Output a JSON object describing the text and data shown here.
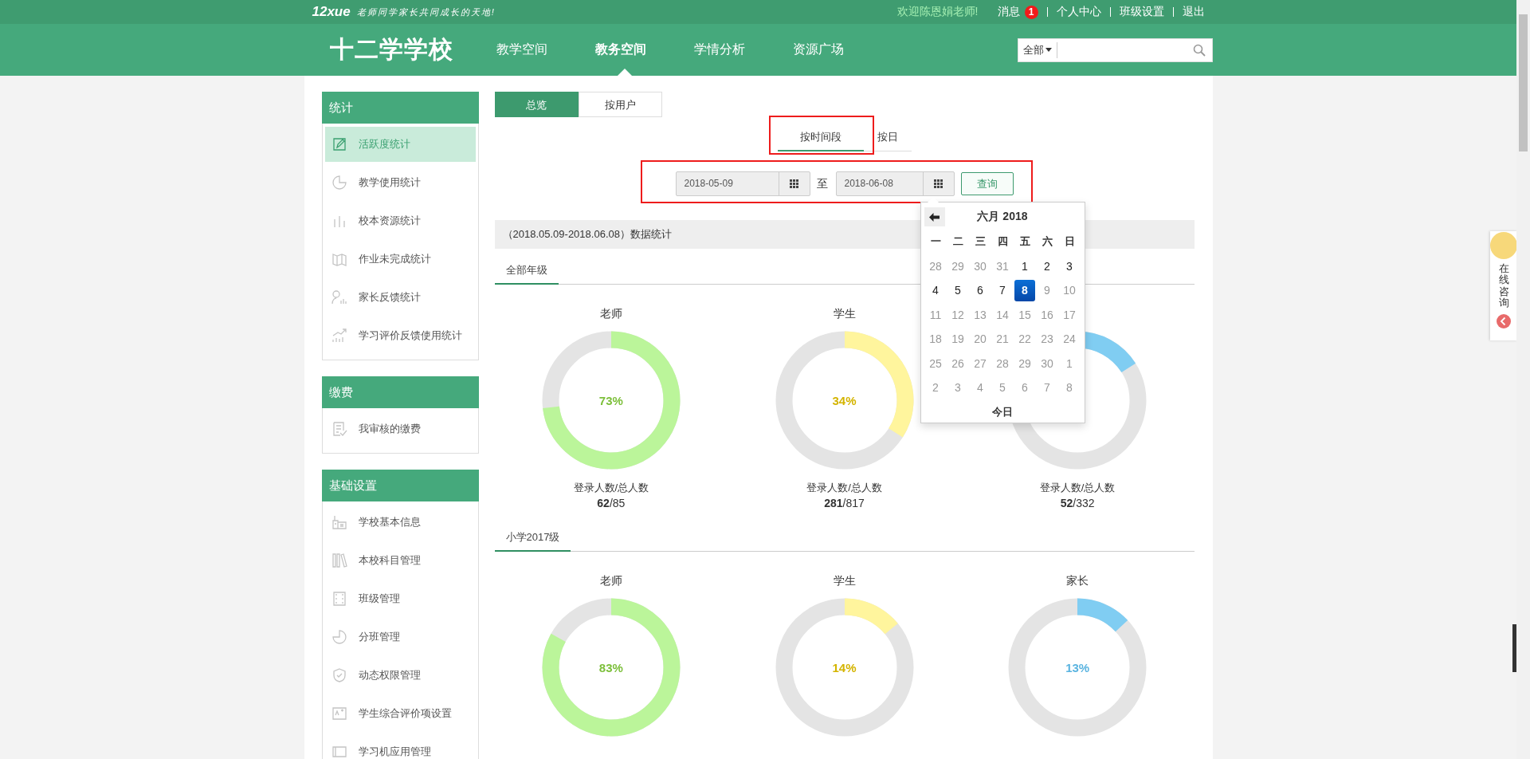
{
  "topbar": {
    "logo": "12xue",
    "tagline": "老师同学家长共同成长的天地!",
    "welcome": "欢迎陈恩娟老师!",
    "links": [
      {
        "label": "消息",
        "badge": "1"
      },
      {
        "label": "个人中心"
      },
      {
        "label": "班级设置"
      },
      {
        "label": "退出"
      }
    ]
  },
  "header": {
    "school": "十二学学校",
    "nav": [
      {
        "label": "教学空间",
        "selected": false
      },
      {
        "label": "教务空间",
        "selected": true
      },
      {
        "label": "学情分析",
        "selected": false
      },
      {
        "label": "资源广场",
        "selected": false
      }
    ],
    "search": {
      "scope": "全部"
    }
  },
  "sidebar": [
    {
      "title": "统计",
      "items": [
        {
          "label": "活跃度统计",
          "selected": true
        },
        {
          "label": "教学使用统计",
          "selected": false
        },
        {
          "label": "校本资源统计",
          "selected": false
        },
        {
          "label": "作业未完成统计",
          "selected": false
        },
        {
          "label": "家长反馈统计",
          "selected": false
        },
        {
          "label": "学习评价反馈使用统计",
          "selected": false
        }
      ]
    },
    {
      "title": "缴费",
      "items": [
        {
          "label": "我审核的缴费",
          "selected": false
        }
      ]
    },
    {
      "title": "基础设置",
      "items": [
        {
          "label": "学校基本信息",
          "selected": false
        },
        {
          "label": "本校科目管理",
          "selected": false
        },
        {
          "label": "班级管理",
          "selected": false
        },
        {
          "label": "分班管理",
          "selected": false
        },
        {
          "label": "动态权限管理",
          "selected": false
        },
        {
          "label": "学生综合评价项设置",
          "selected": false
        },
        {
          "label": "学习机应用管理",
          "selected": false
        }
      ]
    }
  ],
  "view_tabs": [
    {
      "label": "总览",
      "selected": true
    },
    {
      "label": "按用户",
      "selected": false
    }
  ],
  "period_tabs": {
    "highlighted": true,
    "tabs": [
      {
        "label": "按时间段",
        "selected": true
      },
      {
        "label": "按日",
        "selected": false
      }
    ]
  },
  "date_range": {
    "highlighted": true,
    "from": "2018-05-09",
    "separator": "至",
    "to": "2018-06-08",
    "query_button": "查询"
  },
  "datepicker": {
    "title": "六月 2018",
    "weekdays": [
      "一",
      "二",
      "三",
      "四",
      "五",
      "六",
      "日"
    ],
    "weeks": [
      [
        {
          "day": "28",
          "disabled": true,
          "selected": false
        },
        {
          "day": "29",
          "disabled": true,
          "selected": false
        },
        {
          "day": "30",
          "disabled": true,
          "selected": false
        },
        {
          "day": "31",
          "disabled": true,
          "selected": false
        },
        {
          "day": "1",
          "disabled": false,
          "selected": false
        },
        {
          "day": "2",
          "disabled": false,
          "selected": false
        },
        {
          "day": "3",
          "disabled": false,
          "selected": false
        }
      ],
      [
        {
          "day": "4",
          "disabled": false,
          "selected": false
        },
        {
          "day": "5",
          "disabled": false,
          "selected": false
        },
        {
          "day": "6",
          "disabled": false,
          "selected": false
        },
        {
          "day": "7",
          "disabled": false,
          "selected": false
        },
        {
          "day": "8",
          "disabled": false,
          "selected": true
        },
        {
          "day": "9",
          "disabled": true,
          "selected": false
        },
        {
          "day": "10",
          "disabled": true,
          "selected": false
        }
      ],
      [
        {
          "day": "11",
          "disabled": true,
          "selected": false
        },
        {
          "day": "12",
          "disabled": true,
          "selected": false
        },
        {
          "day": "13",
          "disabled": true,
          "selected": false
        },
        {
          "day": "14",
          "disabled": true,
          "selected": false
        },
        {
          "day": "15",
          "disabled": true,
          "selected": false
        },
        {
          "day": "16",
          "disabled": true,
          "selected": false
        },
        {
          "day": "17",
          "disabled": true,
          "selected": false
        }
      ],
      [
        {
          "day": "18",
          "disabled": true,
          "selected": false
        },
        {
          "day": "19",
          "disabled": true,
          "selected": false
        },
        {
          "day": "20",
          "disabled": true,
          "selected": false
        },
        {
          "day": "21",
          "disabled": true,
          "selected": false
        },
        {
          "day": "22",
          "disabled": true,
          "selected": false
        },
        {
          "day": "23",
          "disabled": true,
          "selected": false
        },
        {
          "day": "24",
          "disabled": true,
          "selected": false
        }
      ],
      [
        {
          "day": "25",
          "disabled": true,
          "selected": false
        },
        {
          "day": "26",
          "disabled": true,
          "selected": false
        },
        {
          "day": "27",
          "disabled": true,
          "selected": false
        },
        {
          "day": "28",
          "disabled": true,
          "selected": false
        },
        {
          "day": "29",
          "disabled": true,
          "selected": false
        },
        {
          "day": "30",
          "disabled": true,
          "selected": false
        },
        {
          "day": "1",
          "disabled": true,
          "selected": false
        }
      ],
      [
        {
          "day": "2",
          "disabled": true,
          "selected": false
        },
        {
          "day": "3",
          "disabled": true,
          "selected": false
        },
        {
          "day": "4",
          "disabled": true,
          "selected": false
        },
        {
          "day": "5",
          "disabled": true,
          "selected": false
        },
        {
          "day": "6",
          "disabled": true,
          "selected": false
        },
        {
          "day": "7",
          "disabled": true,
          "selected": false
        },
        {
          "day": "8",
          "disabled": true,
          "selected": false
        }
      ]
    ],
    "today": "今日"
  },
  "summary": "（2018.05.09-2018.06.08）数据统计",
  "groups": [
    {
      "name": "全部年级",
      "charts": [
        {
          "kind": "teacher",
          "title": "老师",
          "level": 0.73,
          "percent": "73%",
          "caption": "登录人数/总人数",
          "count": "**62**/85"
        },
        {
          "kind": "student",
          "title": "学生",
          "level": 0.34,
          "percent": "34%",
          "caption": "登录人数/总人数",
          "count": "**281**/817"
        },
        {
          "kind": "parent",
          "level": 0.16,
          "caption": "登录人数/总人数",
          "count": "**52**/332"
        }
      ]
    },
    {
      "name": "小学2017级",
      "charts": [
        {
          "kind": "teacher",
          "title": "老师",
          "level": 0.83,
          "percent": "83%"
        },
        {
          "kind": "student",
          "title": "学生",
          "level": 0.14,
          "percent": "14%"
        },
        {
          "kind": "parent",
          "title": "家长",
          "level": 0.13,
          "percent": "13%"
        }
      ]
    }
  ],
  "consult": {
    "label": "在线咨询"
  }
}
